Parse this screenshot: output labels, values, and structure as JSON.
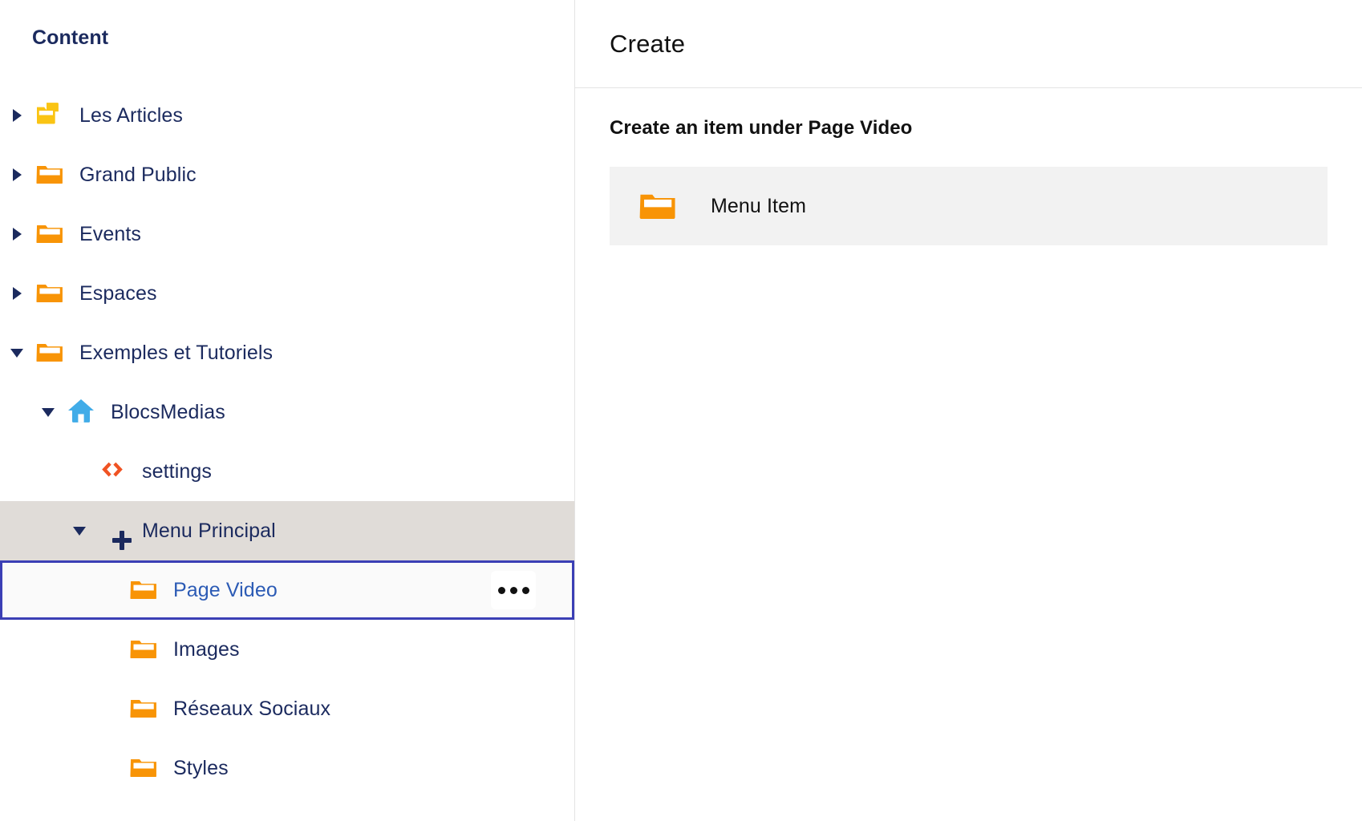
{
  "sidebar": {
    "title": "Content",
    "items": [
      {
        "label": "Les Articles",
        "icon": "folder-open-yellow-icon",
        "indent": 0,
        "toggle": "collapsed",
        "state": "normal"
      },
      {
        "label": "Grand Public",
        "icon": "folder-orange-icon",
        "indent": 0,
        "toggle": "collapsed",
        "state": "normal"
      },
      {
        "label": "Events",
        "icon": "folder-orange-icon",
        "indent": 0,
        "toggle": "collapsed",
        "state": "normal"
      },
      {
        "label": "Espaces",
        "icon": "folder-orange-icon",
        "indent": 0,
        "toggle": "collapsed",
        "state": "normal"
      },
      {
        "label": "Exemples et Tutoriels",
        "icon": "folder-orange-icon",
        "indent": 0,
        "toggle": "expanded",
        "state": "normal"
      },
      {
        "label": "BlocsMedias",
        "icon": "home-blue-icon",
        "indent": 1,
        "toggle": "expanded",
        "state": "normal"
      },
      {
        "label": "settings",
        "icon": "code-brackets-icon",
        "indent": 2,
        "toggle": "none",
        "state": "normal"
      },
      {
        "label": "Menu Principal",
        "icon": "plus-icon",
        "indent": 2,
        "toggle": "expanded",
        "state": "highlighted"
      },
      {
        "label": "Page Video",
        "icon": "folder-orange-icon",
        "indent": 3,
        "toggle": "none",
        "state": "selected",
        "more_label": "•••"
      },
      {
        "label": "Images",
        "icon": "folder-orange-icon",
        "indent": 3,
        "toggle": "none",
        "state": "normal"
      },
      {
        "label": "Réseaux Sociaux",
        "icon": "folder-orange-icon",
        "indent": 3,
        "toggle": "none",
        "state": "normal"
      },
      {
        "label": "Styles",
        "icon": "folder-orange-icon",
        "indent": 3,
        "toggle": "none",
        "state": "normal"
      }
    ]
  },
  "main": {
    "header_title": "Create",
    "section_heading": "Create an item under Page Video",
    "create_options": [
      {
        "label": "Menu Item",
        "icon": "folder-orange-icon"
      }
    ]
  },
  "colors": {
    "text_navy": "#1b2a5e",
    "link_blue": "#2c5bb5",
    "folder_orange": "#f89406",
    "folder_yellow": "#fac414",
    "home_blue": "#41ace8",
    "code_orange": "#f05323",
    "focus_indigo": "#3b3fb5",
    "row_highlight": "#e0dcd8",
    "card_grey": "#f2f2f2",
    "divider": "#e3e3e3"
  }
}
